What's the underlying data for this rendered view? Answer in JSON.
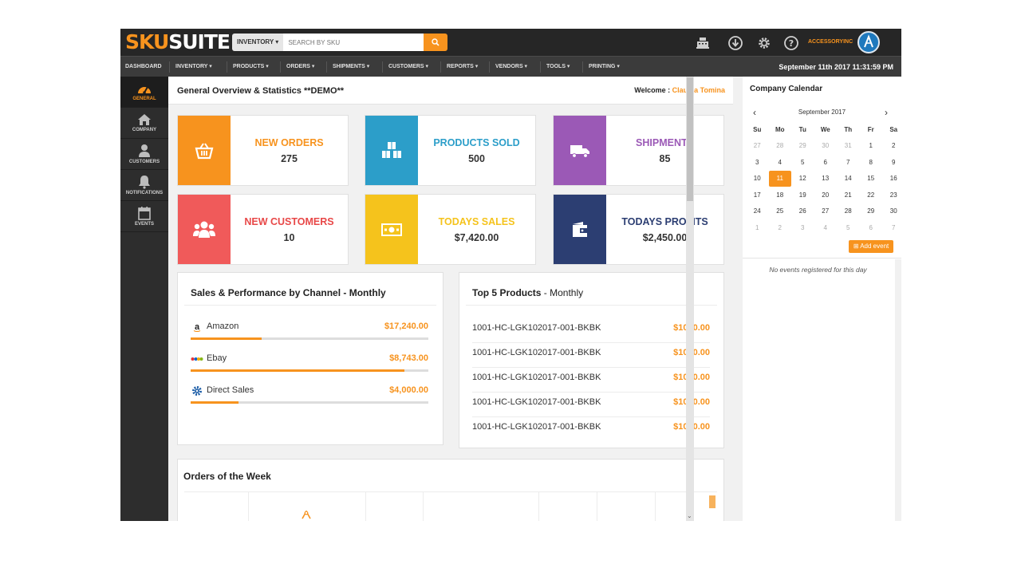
{
  "app": {
    "logo_part1": "SKU",
    "logo_part2": "SUITE",
    "search_dropdown": "INVENTORY ▾",
    "search_placeholder": "SEARCH BY SKU",
    "account_name": "ACCESSORYINC",
    "icons": [
      "cash-register-icon",
      "download-icon",
      "gear-icon",
      "help-icon",
      "search-icon"
    ],
    "accent_color": "#f7931e"
  },
  "nav": {
    "items": [
      "DASHBOARD",
      "INVENTORY ▾",
      "PRODUCTS ▾",
      "ORDERS ▾",
      "SHIPMENTS ▾",
      "CUSTOMERS ▾",
      "REPORTS ▾",
      "VENDORS ▾",
      "TOOLS ▾",
      "PRINTING ▾"
    ],
    "datetime": "September 11th 2017 11:31:59 PM"
  },
  "sidebar": {
    "items": [
      {
        "label": "GENERAL",
        "icon": "dashboard-icon"
      },
      {
        "label": "COMPANY",
        "icon": "home-icon"
      },
      {
        "label": "CUSTOMERS",
        "icon": "user-icon"
      },
      {
        "label": "NOTIFICATIONS",
        "icon": "bell-icon"
      },
      {
        "label": "EVENTS",
        "icon": "calendar-icon"
      }
    ]
  },
  "main": {
    "title": "General Overview & Statistics **DEMO**",
    "welcome_label": "Welcome : ",
    "welcome_name": "Claudia Tomina",
    "stats": [
      {
        "title": "NEW ORDERS",
        "value": "275",
        "color": "#f7931e",
        "title_color": "#f7931e",
        "icon": "basket-icon"
      },
      {
        "title": "PRODUCTS SOLD",
        "value": "500",
        "color": "#2c9ec9",
        "title_color": "#2c9ec9",
        "icon": "boxes-icon"
      },
      {
        "title": "SHIPMENTS",
        "value": "85",
        "color": "#9b59b6",
        "title_color": "#9b59b6",
        "icon": "truck-icon"
      },
      {
        "title": "NEW CUSTOMERS",
        "value": "10",
        "color": "#f05a5a",
        "title_color": "#e84848",
        "icon": "users-icon"
      },
      {
        "title": "TODAYS SALES",
        "value": "$7,420.00",
        "color": "#f5c31c",
        "title_color": "#f5c31c",
        "icon": "money-icon"
      },
      {
        "title": "TODAYS PROFITS",
        "value": "$2,450.00",
        "color": "#2c3e72",
        "title_color": "#2c3e72",
        "icon": "wallet-icon"
      }
    ],
    "channels": {
      "title": "Sales & Performance by Channel - Monthly",
      "rows": [
        {
          "name": "Amazon",
          "value": "$17,240.00",
          "fill": 0.3,
          "icon": "amazon-icon"
        },
        {
          "name": "Ebay",
          "value": "$8,743.00",
          "fill": 0.9,
          "icon": "ebay-icon"
        },
        {
          "name": "Direct Sales",
          "value": "$4,000.00",
          "fill": 0.2,
          "icon": "gear-icon"
        }
      ]
    },
    "top_products": {
      "title_bold": "Top 5 Products",
      "title_rest": " - Monthly",
      "rows": [
        {
          "name": "1001-HC-LGK102017-001-BKBK",
          "value": "$1000.00"
        },
        {
          "name": "1001-HC-LGK102017-001-BKBK",
          "value": "$1000.00"
        },
        {
          "name": "1001-HC-LGK102017-001-BKBK",
          "value": "$1000.00"
        },
        {
          "name": "1001-HC-LGK102017-001-BKBK",
          "value": "$1000.00"
        },
        {
          "name": "1001-HC-LGK102017-001-BKBK",
          "value": "$1000.00"
        }
      ]
    },
    "orders_week": {
      "title": "Orders of the Week"
    }
  },
  "calendar": {
    "title": "Company Calendar",
    "month": "September 2017",
    "weekdays": [
      "Su",
      "Mo",
      "Tu",
      "We",
      "Th",
      "Fr",
      "Sa"
    ],
    "days": [
      [
        "27",
        "28",
        "29",
        "30",
        "31",
        "1",
        "2"
      ],
      [
        "3",
        "4",
        "5",
        "6",
        "7",
        "8",
        "9"
      ],
      [
        "10",
        "11",
        "12",
        "13",
        "14",
        "15",
        "16"
      ],
      [
        "17",
        "18",
        "19",
        "20",
        "21",
        "22",
        "23"
      ],
      [
        "24",
        "25",
        "26",
        "27",
        "28",
        "29",
        "30"
      ],
      [
        "1",
        "2",
        "3",
        "4",
        "5",
        "6",
        "7"
      ]
    ],
    "today": "11",
    "add_event": "Add event",
    "no_events": "No events registered for this day"
  }
}
